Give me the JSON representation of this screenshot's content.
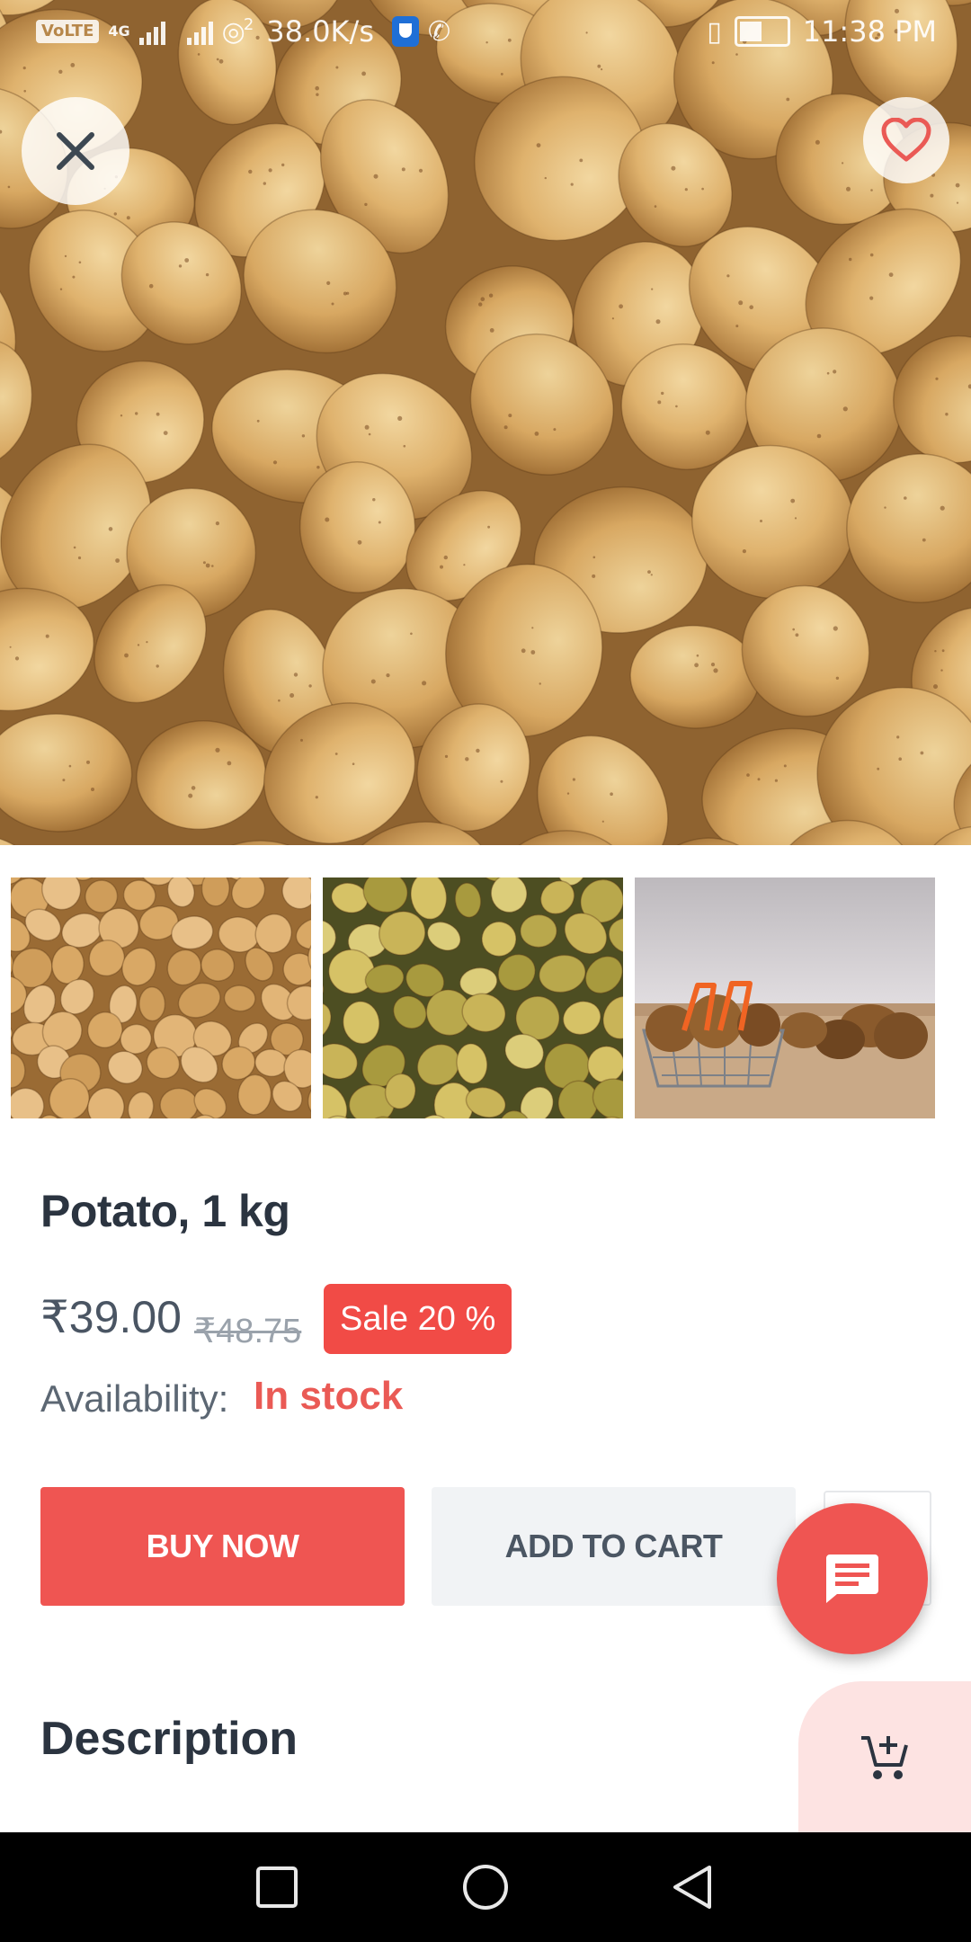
{
  "status_bar": {
    "network_badge": "VoLTE",
    "network_type": "4G",
    "hotspot_count": "2",
    "speed": "38.0K/s",
    "time": "11:38 PM",
    "icons": [
      "volte-icon",
      "signal-icon",
      "hotspot-icon",
      "shield-icon",
      "whatsapp-icon",
      "vibrate-icon",
      "battery-icon"
    ]
  },
  "hero": {
    "close_icon": "close-icon",
    "favorite_icon": "heart-outline-icon"
  },
  "gallery": {
    "thumbnails": [
      "potatoes-yellow",
      "potatoes-green",
      "potatoes-basket"
    ]
  },
  "product": {
    "title": "Potato, 1 kg",
    "price": "₹39.00",
    "old_price": "₹48.75",
    "sale_badge": "Sale 20 %",
    "availability_label": "Availability:",
    "availability_value": "In stock"
  },
  "actions": {
    "buy_now": "BUY NOW",
    "add_to_cart": "ADD TO CART",
    "chat_icon": "chat-icon",
    "cart_add_icon": "cart-add-icon"
  },
  "description": {
    "heading": "Description"
  },
  "nav_bar": {
    "items": [
      "recents-square-icon",
      "home-circle-icon",
      "back-triangle-icon"
    ]
  },
  "colors": {
    "accent": "#ef5552",
    "sale_badge": "#f14b46",
    "in_stock": "#ea5a55",
    "secondary_button": "#f1f3f5",
    "cart_panel": "#fde3e2",
    "text_dark": "#2b3440"
  }
}
